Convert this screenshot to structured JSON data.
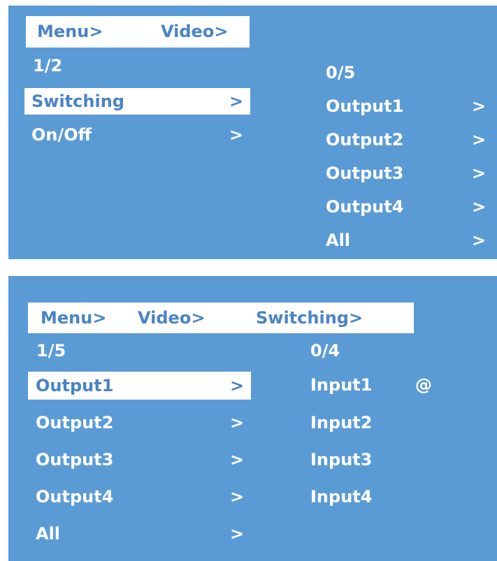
{
  "panel1": {
    "breadcrumb": [
      "Menu>",
      "Video>"
    ],
    "left_page": "1/2",
    "left_items": [
      {
        "label": "Switching",
        "arrow": ">",
        "selected": true
      },
      {
        "label": "On/Off",
        "arrow": ">",
        "selected": false
      }
    ],
    "right_page": "0/5",
    "right_items": [
      {
        "label": "Output1",
        "arrow": ">"
      },
      {
        "label": "Output2",
        "arrow": ">"
      },
      {
        "label": "Output3",
        "arrow": ">"
      },
      {
        "label": "Output4",
        "arrow": ">"
      },
      {
        "label": "All",
        "arrow": ">"
      }
    ]
  },
  "panel2": {
    "breadcrumb": [
      "Menu>",
      "Video>",
      "Switching>"
    ],
    "left_page": "1/5",
    "left_items": [
      {
        "label": "Output1",
        "arrow": ">",
        "selected": true
      },
      {
        "label": "Output2",
        "arrow": ">",
        "selected": false
      },
      {
        "label": "Output3",
        "arrow": ">",
        "selected": false
      },
      {
        "label": "Output4",
        "arrow": ">",
        "selected": false
      },
      {
        "label": "All",
        "arrow": ">",
        "selected": false
      }
    ],
    "right_page": "0/4",
    "right_items": [
      {
        "label": "Input1",
        "mark": "@"
      },
      {
        "label": "Input2",
        "mark": ""
      },
      {
        "label": "Input3",
        "mark": ""
      },
      {
        "label": "Input4",
        "mark": ""
      }
    ]
  },
  "colors": {
    "panel_bg": "#5b9bd5",
    "text": "#ffffff",
    "highlight_bg": "#ffffff",
    "highlight_text": "#4a84c4"
  }
}
